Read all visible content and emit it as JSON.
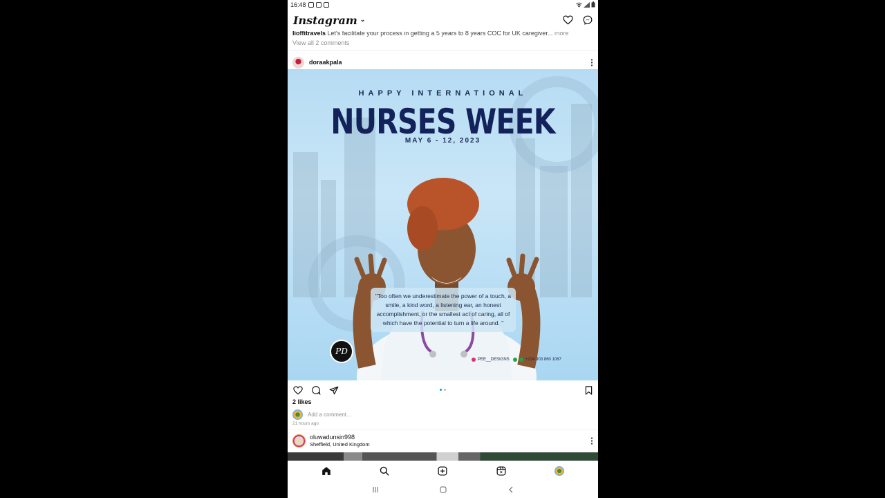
{
  "status_bar": {
    "time": "16:48"
  },
  "app": {
    "title": "Instagram",
    "title_chevron": "⌄"
  },
  "previous_post": {
    "caption_user": "lioffitravels",
    "caption_text": "Let's facilitate your process in getting a 5 years to 8 years COC for UK caregiver...",
    "caption_more": "more",
    "view_comments": "View all 2 comments"
  },
  "post": {
    "username": "doraakpala",
    "image": {
      "happy": "HAPPY INTERNATIONAL",
      "title": "NURSES WEEK",
      "dates": "MAY 6 - 12, 2023",
      "quote": "\"Too often we underestimate the power of a touch, a smile, a kind word, a listening ear, an honest accomplishment, or the smallest act of caring, all of which have the potential to turn a life around. \"",
      "badge": "PD",
      "handle": "PEE__DESIGNS",
      "phone": "+234 903 860 1067"
    },
    "likes": "2 likes",
    "comment_placeholder": "Add a comment...",
    "time_ago": "21 hours ago"
  },
  "next_post": {
    "username": "oluwadunsin998",
    "location": "Sheffield, United Kingdom"
  },
  "colors": {
    "accent": "#0095f6",
    "title_navy": "#13225a",
    "image_bg": "#b6dcf3"
  },
  "icons": {
    "top": [
      "heart-icon",
      "messenger-icon"
    ],
    "actions": [
      "heart-icon",
      "comment-icon",
      "share-icon",
      "bookmark-icon"
    ],
    "bottom_nav": [
      "home-icon",
      "search-icon",
      "create-icon",
      "reels-icon",
      "profile-icon"
    ],
    "system_nav": [
      "recents-icon",
      "home-button-icon",
      "back-icon"
    ]
  }
}
